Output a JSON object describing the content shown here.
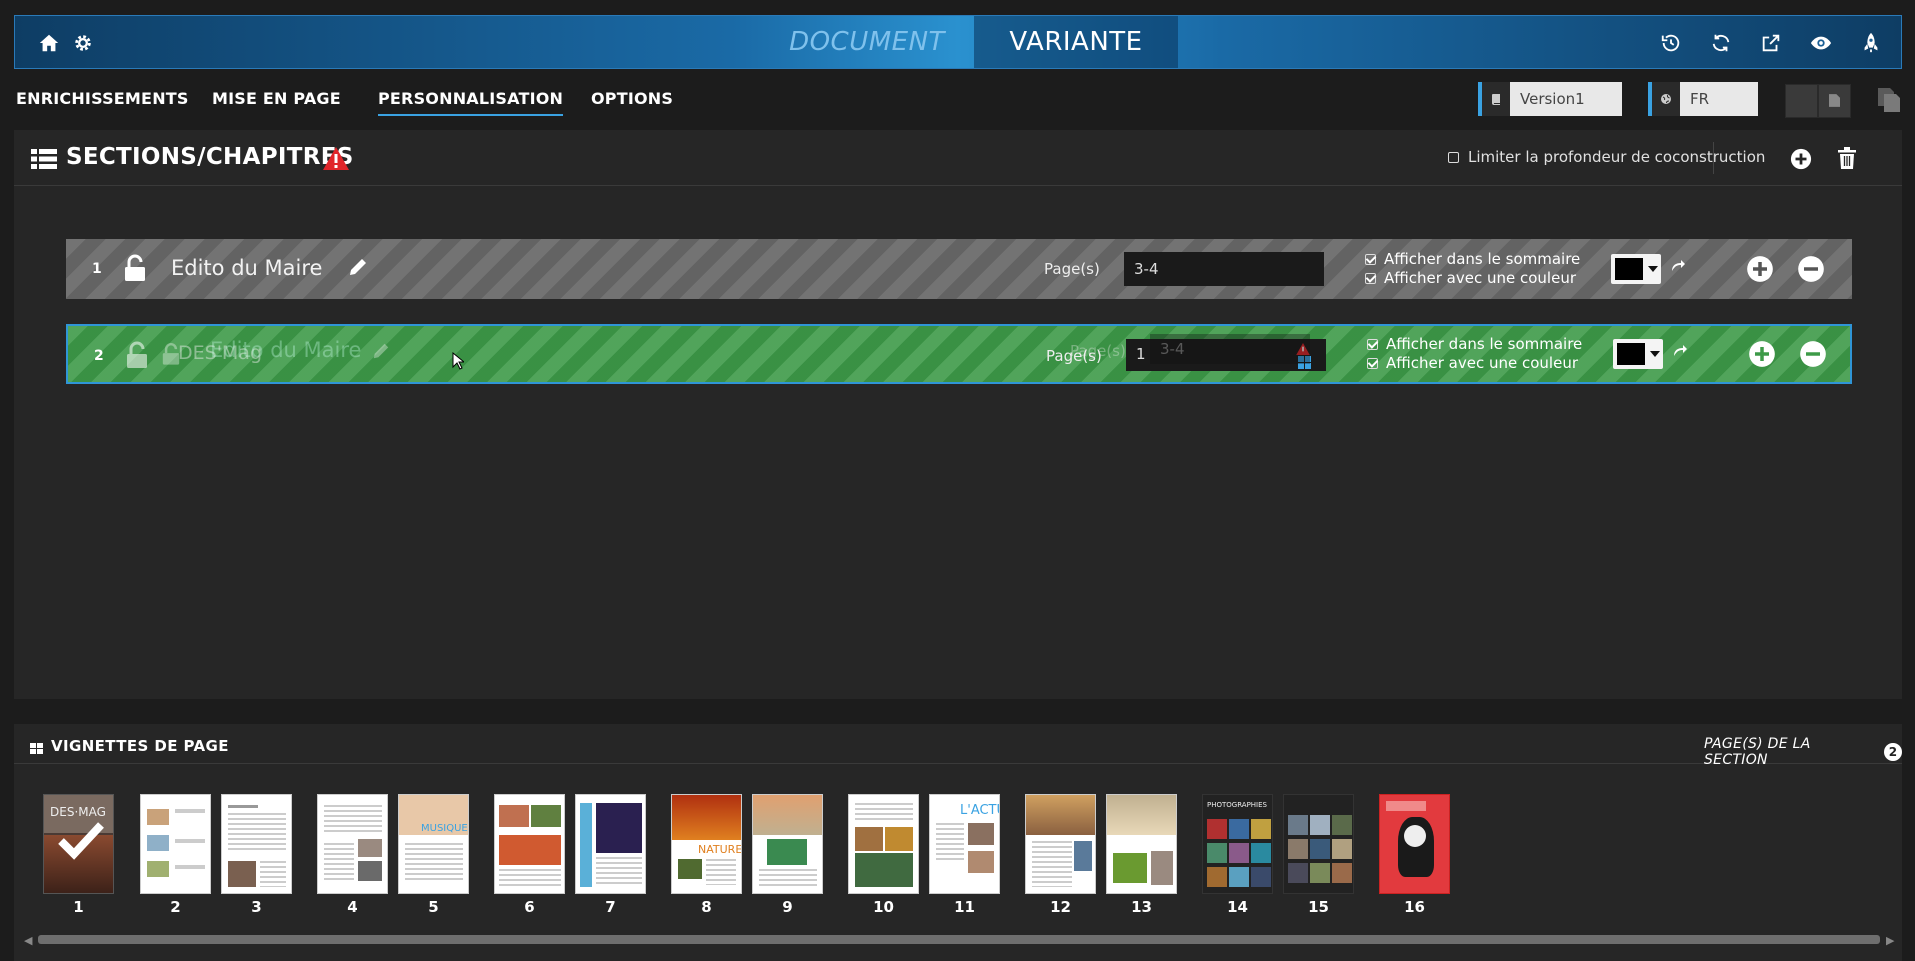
{
  "header": {
    "tabs": [
      {
        "label": "DOCUMENT",
        "active": false
      },
      {
        "label": "VARIANTE",
        "active": true
      }
    ],
    "left_icons": [
      "home-icon",
      "gear-icon"
    ],
    "right_icons": [
      "history-icon",
      "refresh-icon",
      "external-link-icon",
      "eye-icon",
      "rocket-icon"
    ]
  },
  "menu": {
    "items": [
      "ENRICHISSEMENTS",
      "MISE EN PAGE",
      "PERSONNALISATION",
      "OPTIONS"
    ],
    "active": "PERSONNALISATION",
    "version_value": "Version1",
    "language_value": "FR"
  },
  "sections": {
    "title": "SECTIONS/CHAPITRES",
    "limit_label": "Limiter la profondeur de coconstruction",
    "limit_checked": false,
    "pages_label": "Page(s)",
    "rows": [
      {
        "num": "1",
        "title": "Edito du Maire",
        "pages": "3-4",
        "opt_summary": "Afficher dans le sommaire",
        "opt_color": "Afficher avec une couleur",
        "color": "#000000",
        "selected": false
      },
      {
        "num": "2",
        "title": "DES'Mag",
        "pages": "1",
        "opt_summary": "Afficher dans le sommaire",
        "opt_color": "Afficher avec une couleur",
        "color": "#000000",
        "selected": true
      }
    ],
    "ghost": {
      "title": "Edito du Maire",
      "pages": "3-4"
    }
  },
  "thumbnails": {
    "title": "VIGNETTES DE PAGE",
    "section_pages_label": "PAGE(S) DE LA SECTION",
    "section_pages_count": "2",
    "pages": [
      "1",
      "2",
      "3",
      "4",
      "5",
      "6",
      "7",
      "8",
      "9",
      "10",
      "11",
      "12",
      "13",
      "14",
      "15",
      "16"
    ]
  },
  "colors": {
    "accent": "#3aa2e2",
    "selected_row": "#3d9a48",
    "warning": "#e0262a"
  }
}
